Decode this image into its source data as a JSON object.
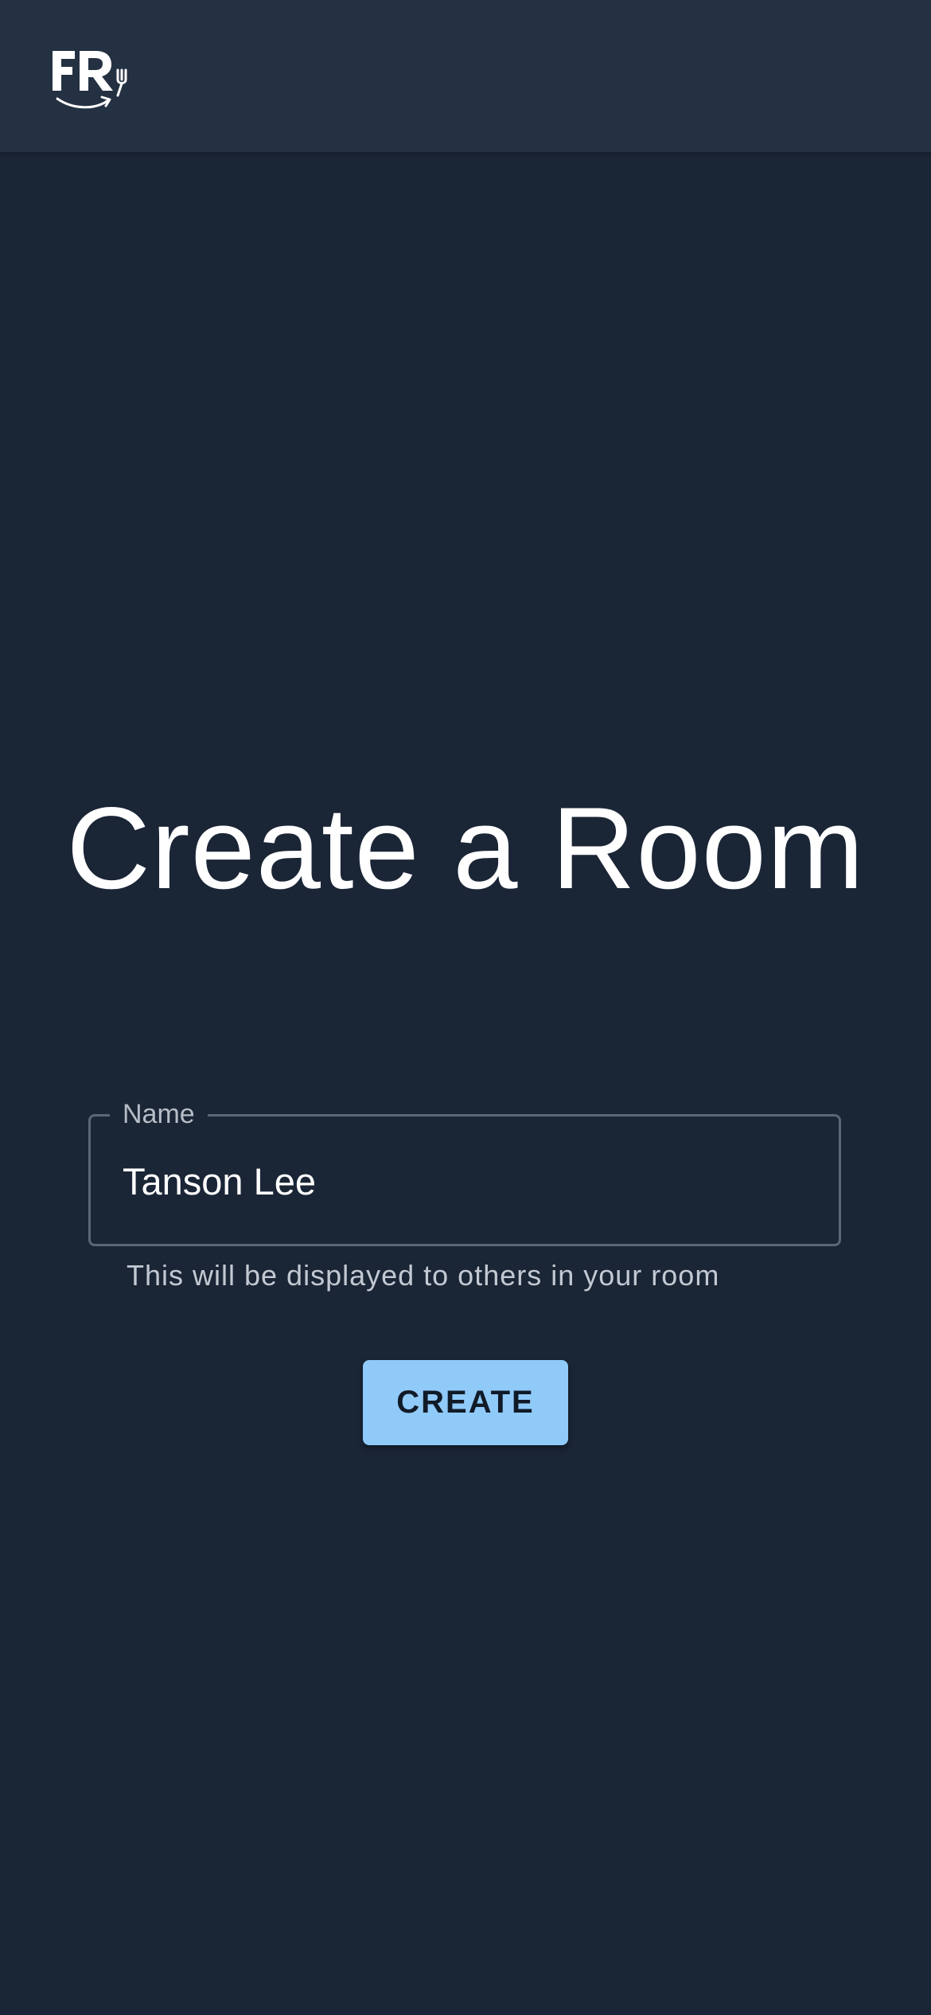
{
  "header": {
    "logo_icon": "fr-fork-logo-icon",
    "logo_text": "FR"
  },
  "main": {
    "title": "Create a Room",
    "name_field": {
      "label": "Name",
      "value": "Tanson Lee",
      "helper_text": "This will be displayed to others in your room"
    },
    "create_button_label": "CREATE"
  },
  "colors": {
    "background": "#1a2536",
    "appbar": "#243142",
    "primary_button": "#90caf9",
    "text": "#ffffff"
  }
}
